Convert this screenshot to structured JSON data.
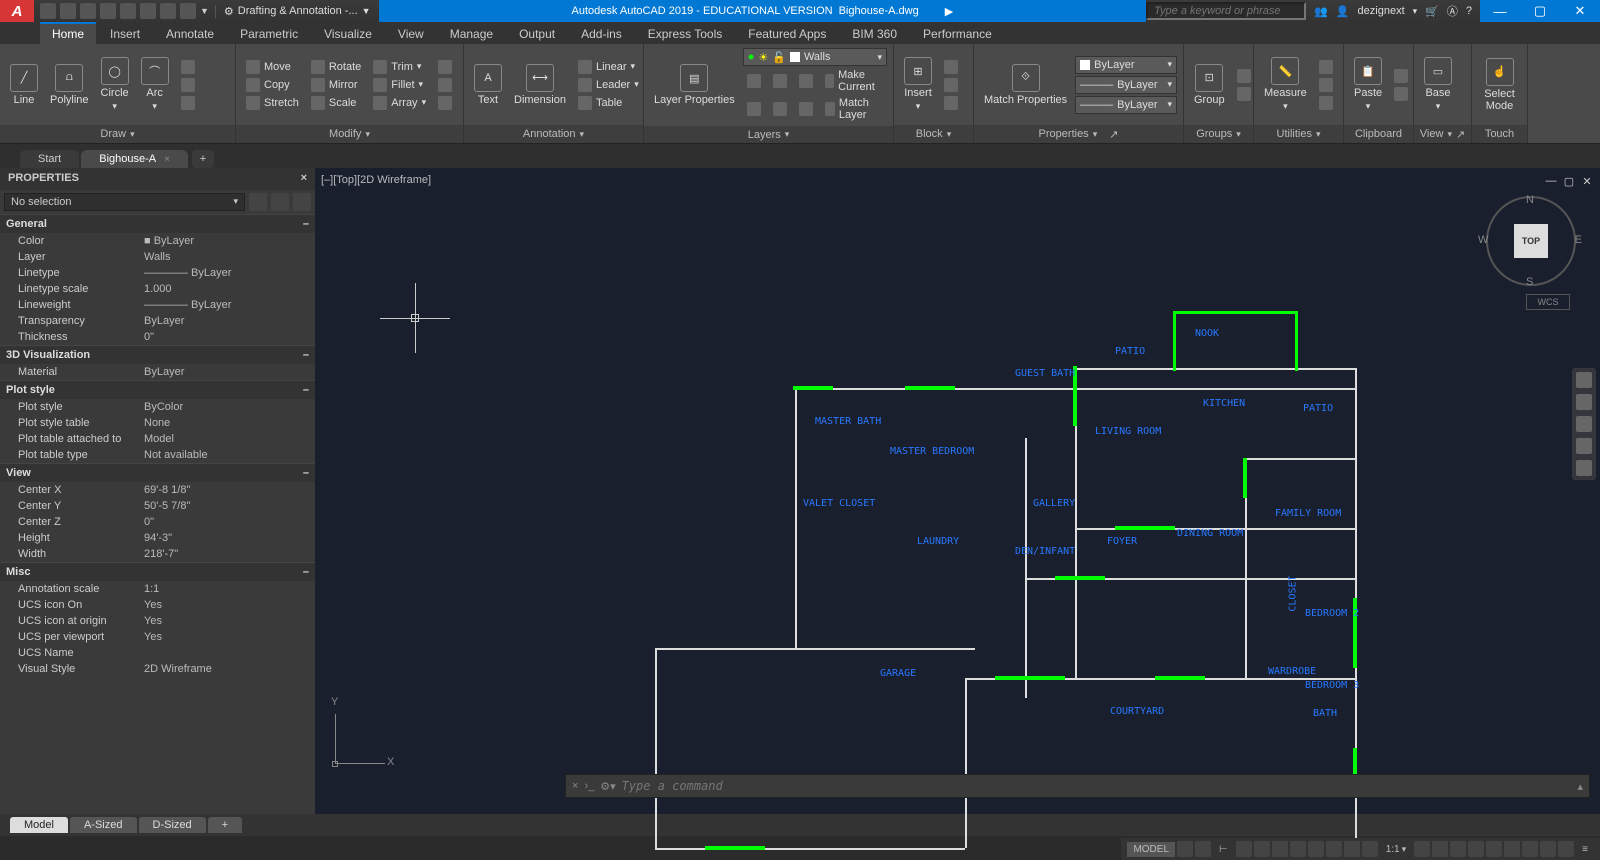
{
  "title": {
    "app": "Autodesk AutoCAD 2019 - EDUCATIONAL VERSION",
    "file": "Bighouse-A.dwg",
    "workspace": "Drafting & Annotation -...",
    "search_placeholder": "Type a keyword or phrase",
    "user": "dezignext"
  },
  "menu": [
    "Home",
    "Insert",
    "Annotate",
    "Parametric",
    "Visualize",
    "View",
    "Manage",
    "Output",
    "Add-ins",
    "Express Tools",
    "Featured Apps",
    "BIM 360",
    "Performance"
  ],
  "menu_active": "Home",
  "ribbon": {
    "draw": {
      "title": "Draw",
      "items": [
        "Line",
        "Polyline",
        "Circle",
        "Arc"
      ]
    },
    "modify": {
      "title": "Modify",
      "col1": [
        "Move",
        "Copy",
        "Stretch"
      ],
      "col2": [
        "Rotate",
        "Mirror",
        "Scale"
      ],
      "col3": [
        "Trim",
        "Fillet",
        "Array"
      ]
    },
    "annotation": {
      "title": "Annotation",
      "big": [
        "Text",
        "Dimension"
      ],
      "items": [
        "Linear",
        "Leader",
        "Table"
      ]
    },
    "layers": {
      "title": "Layers",
      "big": "Layer Properties",
      "combo": "Walls",
      "items": [
        "Make Current",
        "Match Layer"
      ]
    },
    "block": {
      "title": "Block",
      "big": "Insert"
    },
    "properties": {
      "title": "Properties",
      "big": "Match Properties",
      "combo1": "ByLayer",
      "combo2": "ByLayer",
      "combo3": "ByLayer"
    },
    "groups": {
      "title": "Groups",
      "big": "Group"
    },
    "utilities": {
      "title": "Utilities",
      "big": "Measure"
    },
    "clipboard": {
      "title": "Clipboard",
      "big": "Paste"
    },
    "view": {
      "title": "View",
      "big": "Base"
    },
    "touch": {
      "title": "Touch",
      "big": "Select Mode"
    }
  },
  "filetabs": {
    "tabs": [
      "Start",
      "Bighouse-A"
    ],
    "active": "Bighouse-A"
  },
  "properties_panel": {
    "title": "PROPERTIES",
    "selection": "No selection",
    "sections": {
      "General": [
        {
          "k": "Color",
          "v": "■ ByLayer"
        },
        {
          "k": "Layer",
          "v": "Walls"
        },
        {
          "k": "Linetype",
          "v": "———— ByLayer"
        },
        {
          "k": "Linetype scale",
          "v": "1.000"
        },
        {
          "k": "Lineweight",
          "v": "———— ByLayer"
        },
        {
          "k": "Transparency",
          "v": "ByLayer"
        },
        {
          "k": "Thickness",
          "v": "0\""
        }
      ],
      "3D Visualization": [
        {
          "k": "Material",
          "v": "ByLayer"
        }
      ],
      "Plot style": [
        {
          "k": "Plot style",
          "v": "ByColor"
        },
        {
          "k": "Plot style table",
          "v": "None"
        },
        {
          "k": "Plot table attached to",
          "v": "Model"
        },
        {
          "k": "Plot table type",
          "v": "Not available"
        }
      ],
      "View": [
        {
          "k": "Center X",
          "v": "69'-8 1/8\""
        },
        {
          "k": "Center Y",
          "v": "50'-5 7/8\""
        },
        {
          "k": "Center Z",
          "v": "0\""
        },
        {
          "k": "Height",
          "v": "94'-3\""
        },
        {
          "k": "Width",
          "v": "218'-7\""
        }
      ],
      "Misc": [
        {
          "k": "Annotation scale",
          "v": "1:1"
        },
        {
          "k": "UCS icon On",
          "v": "Yes"
        },
        {
          "k": "UCS icon at origin",
          "v": "Yes"
        },
        {
          "k": "UCS per viewport",
          "v": "Yes"
        },
        {
          "k": "UCS Name",
          "v": ""
        },
        {
          "k": "Visual Style",
          "v": "2D Wireframe"
        }
      ]
    }
  },
  "viewport": {
    "label": "[–][Top][2D Wireframe]",
    "cube": "TOP",
    "wcs": "WCS"
  },
  "rooms": [
    "NOOK",
    "PATIO",
    "KITCHEN",
    "PATIO",
    "MASTER BATH",
    "MASTER BEDROOM",
    "LIVING ROOM",
    "GALLERY",
    "FAMILY ROOM",
    "LAUNDRY",
    "DEN/INFANT",
    "FOYER",
    "DINING ROOM",
    "GARAGE",
    "COURTYARD",
    "BEDROOM 2",
    "BEDROOM 3",
    "BATH",
    "GUEST BATH",
    "WARDROBE",
    "CLOSET",
    "VALET CLOSET"
  ],
  "cmdline_placeholder": "Type a command",
  "modeltabs": [
    "Model",
    "A-Sized",
    "D-Sized"
  ],
  "modeltab_active": "Model",
  "statusbar": {
    "model": "MODEL",
    "scale": "1:1"
  },
  "ucs": {
    "x": "X",
    "y": "Y"
  }
}
